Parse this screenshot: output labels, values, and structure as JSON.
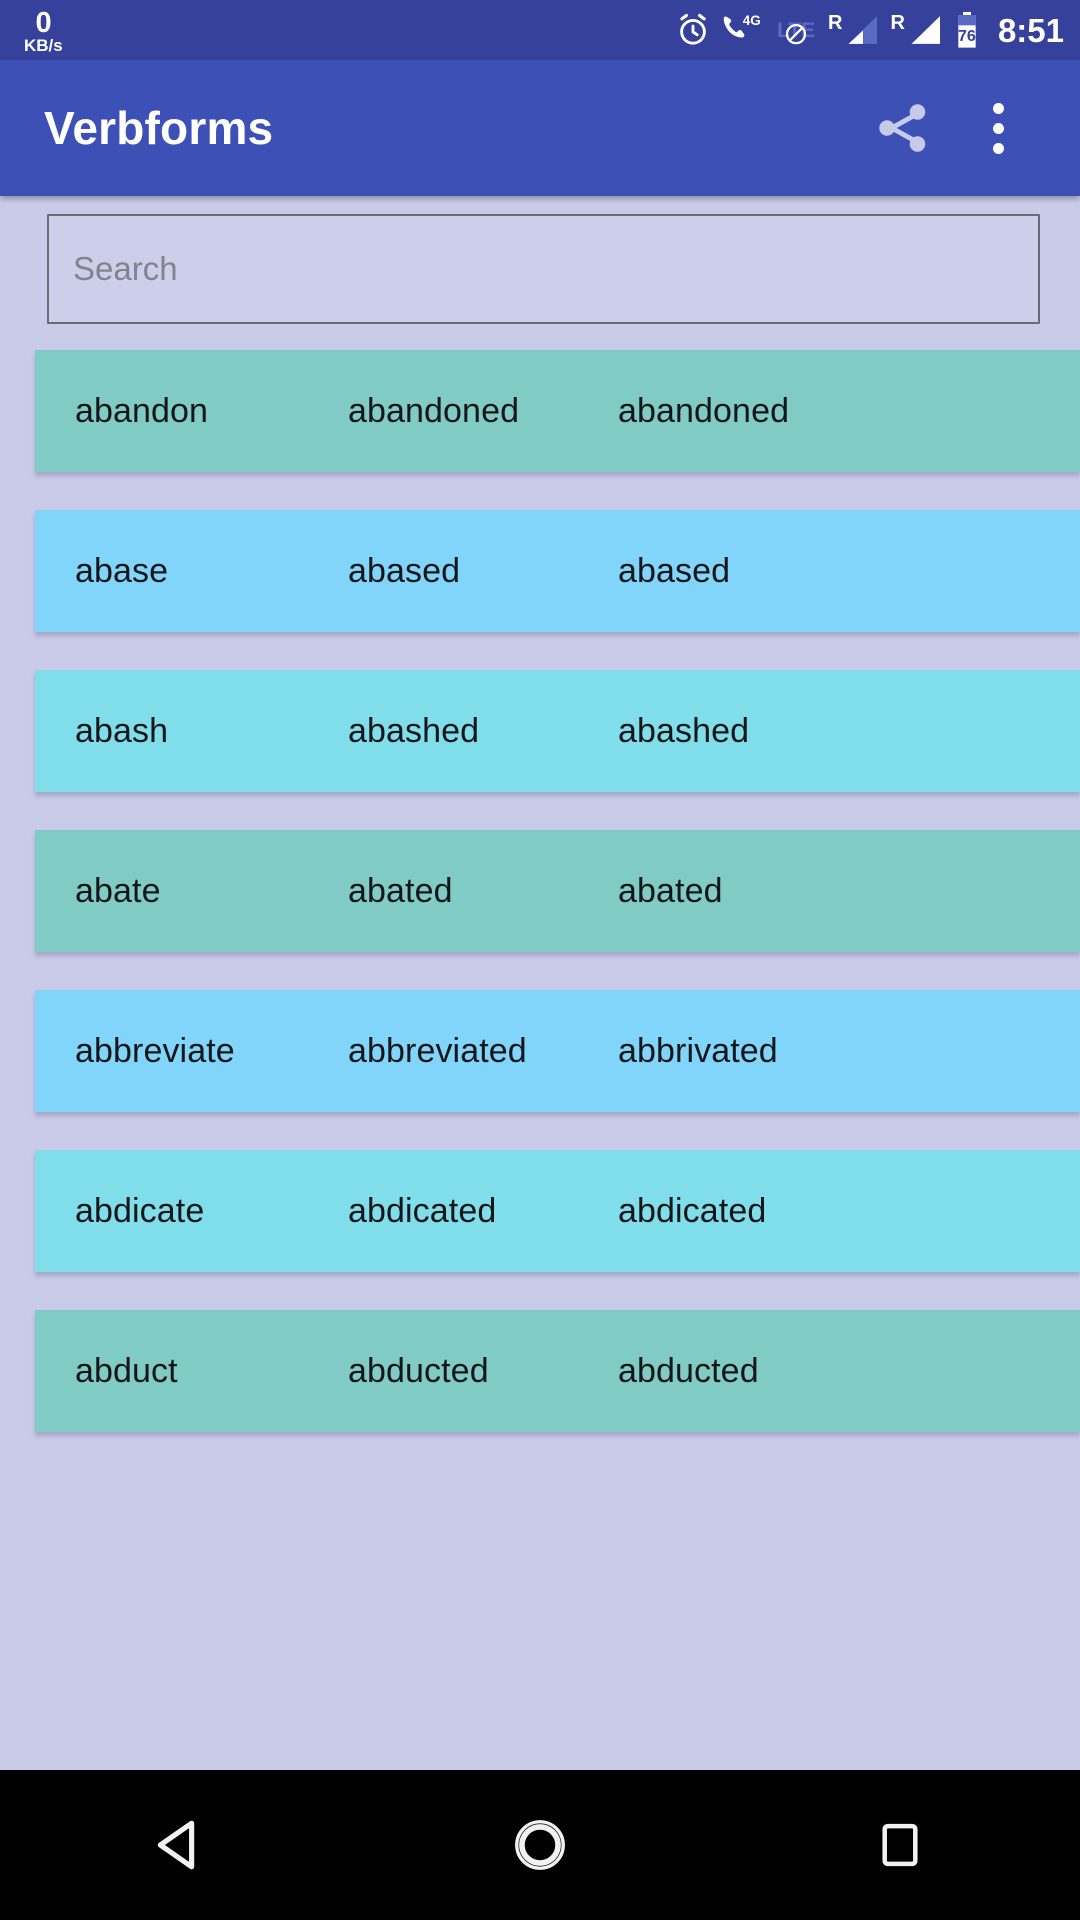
{
  "status_bar": {
    "network_speed_value": "0",
    "network_speed_unit": "KB/s",
    "lte_label": "LTE",
    "roaming_label_1": "R",
    "roaming_label_2": "R",
    "battery_level": "76",
    "clock": "8:51",
    "icons": [
      "alarm-icon",
      "call-4g-icon",
      "lte-no-data-icon",
      "signal-bars-icon",
      "signal-bars-icon",
      "battery-icon"
    ],
    "background_color": "#36419b"
  },
  "app_bar": {
    "title": "Verbforms",
    "share_label": "Share",
    "overflow_label": "More options",
    "background_color": "#3d50b5",
    "title_color": "#ffffff",
    "share_icon_color": "#c5cbe8"
  },
  "search": {
    "placeholder": "Search",
    "value": "",
    "background_color": "#ccceea",
    "border_color": "#6b6b78"
  },
  "page": {
    "background_color": "#c9cbe8"
  },
  "row_colors": [
    "#80cbc4",
    "#81d4fa",
    "#80deea"
  ],
  "table": {
    "rows": [
      {
        "base": "abandon",
        "past": "abandoned",
        "participle": "abandoned",
        "color": "#80cbc4"
      },
      {
        "base": "abase",
        "past": "abased",
        "participle": "abased",
        "color": "#81d4fa"
      },
      {
        "base": "abash",
        "past": "abashed",
        "participle": "abashed",
        "color": "#80deea"
      },
      {
        "base": "abate",
        "past": "abated",
        "participle": "abated",
        "color": "#80cbc4"
      },
      {
        "base": "abbreviate",
        "past": "abbreviated",
        "participle": "abbrivated",
        "color": "#81d4fa"
      },
      {
        "base": "abdicate",
        "past": "abdicated",
        "participle": "abdicated",
        "color": "#80deea"
      },
      {
        "base": "abduct",
        "past": "abducted",
        "participle": "abducted",
        "color": "#80cbc4"
      }
    ]
  },
  "nav_bar": {
    "back_label": "Back",
    "home_label": "Home",
    "recents_label": "Recents",
    "background_color": "#000000"
  }
}
